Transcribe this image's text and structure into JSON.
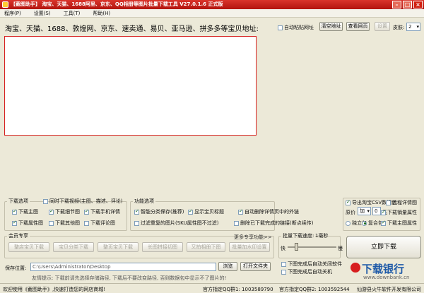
{
  "window": {
    "title": "【截图助手】 淘宝、天猫、1688阿里、京东、QQ相册等图片批量下载工具 V27.0.1.6 正式版"
  },
  "menu": [
    {
      "label": "程序(P)"
    },
    {
      "label": "设置(S)"
    },
    {
      "label": "工具(T)"
    },
    {
      "label": "帮助(H)"
    }
  ],
  "url_bar": {
    "label": "淘宝、天猫、1688、敦煌网、京东、速卖通、易贝、亚马逊、拼多多等宝贝地址:",
    "auto_paste": "自动粘贴网址",
    "clear_btn": "清空地址",
    "open_btn": "查看网页",
    "settings_btn": "设置",
    "skin_label": "皮肤:",
    "skin_value": "2"
  },
  "download_options": {
    "title": "下载选项",
    "sync_video": "同时下载视频(主图、描述、评论)",
    "items": [
      {
        "label": "下载主图",
        "checked": true
      },
      {
        "label": "下载细节图",
        "checked": true
      },
      {
        "label": "下载手机详情",
        "checked": true
      },
      {
        "label": "下载属性图",
        "checked": true
      },
      {
        "label": "下载其他图",
        "checked": false
      },
      {
        "label": "下载评论图",
        "checked": false
      }
    ]
  },
  "feature_options": {
    "title": "功能选项",
    "smart_classify": "智能分类保存(推荐)",
    "show_titles": "显示宝贝标题",
    "auto_delete": "自动删除详情页中的外链",
    "filter_dup": "过滤重复的图片(SKU属性图不过滤)",
    "delete_done": "删除已下载完成的链接(断点续传)"
  },
  "right_options": {
    "export_csv": "导出淘宝CSV数据包",
    "far_detail": "远程详情图",
    "price_label": "原价",
    "price_op": "加",
    "price_value": "0",
    "price_unit": "元",
    "download_sales": "下载销量属性",
    "standalone": "独立包",
    "combined": "复合包",
    "download_main_attr": "下载主图属性"
  },
  "member": {
    "title": "会员专享",
    "more": "更多专享功能>>",
    "buttons": [
      "整店宝贝下载",
      "宝贝分类下载",
      "整页宝贝下载",
      "长图拼接切图",
      "又拍相册下图",
      "批量加水印设置"
    ]
  },
  "speed": {
    "title": "批量下载速度:",
    "interval": "1毫秒",
    "fast": "快",
    "slow": "慢",
    "progress": 0.18
  },
  "download_now": "立即下载",
  "save": {
    "label": "保存位置:",
    "path": "C:\\Users\\Administrator\\Desktop",
    "browse_btn": "浏览",
    "open_folder_btn": "打开文件夹",
    "after_done_1": "下图完成后自动关闭软件",
    "after_done_2": "下图完成后自动关机"
  },
  "tip": "友情提示: 下载前请先选择存储路径, 下载后不要改变路径, 否则数据包中显示不了图片的!",
  "status": {
    "welcome": "欢迎使用《截图助手》,快速打造您的网店商城!",
    "qq1": "官方指定QQ群1: 1003589790",
    "qq2": "官方指定QQ群2: 1003592544",
    "company": "仙游县火牛软件开发有限公司"
  },
  "watermark": {
    "brand": "下载银行",
    "url": "www.downbank.cn"
  },
  "colors": {
    "titlebar": "#c0201a",
    "url_box_border": "#d62020"
  }
}
